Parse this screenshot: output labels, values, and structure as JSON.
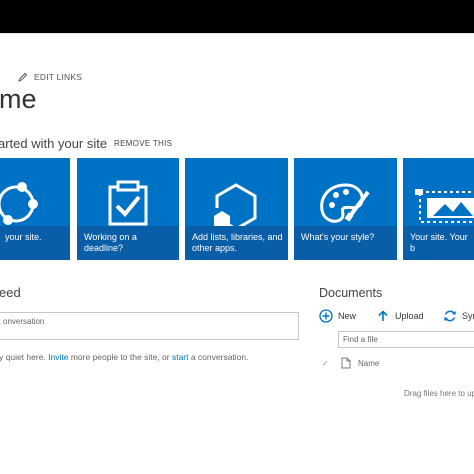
{
  "header": {
    "edit_links": "EDIT LINKS",
    "title": "me"
  },
  "getting_started": {
    "heading": "arted with your site",
    "remove": "REMOVE THIS",
    "tiles": [
      {
        "label": "your site.",
        "icon": "share-network-icon"
      },
      {
        "label": "Working on a deadline?",
        "icon": "clipboard-check-icon"
      },
      {
        "label": "Add lists, libraries, and other apps.",
        "icon": "add-app-hexagon-icon"
      },
      {
        "label": "What's your style?",
        "icon": "palette-icon"
      },
      {
        "label": "Your site. Your b",
        "icon": "site-picture-icon"
      }
    ]
  },
  "newsfeed": {
    "title": "eed",
    "placeholder": "onversation",
    "note_prefix": "y quiet here. ",
    "invite_link": "Invite",
    "note_middle": " more people to the site, or ",
    "start_link": "start",
    "note_suffix": " a conversation."
  },
  "documents": {
    "title": "Documents",
    "new_label": "New",
    "upload_label": "Upload",
    "sync_label": "Syn",
    "find_placeholder": "Find a file",
    "name_column": "Name",
    "drop_text": "Drag files here to up"
  },
  "colors": {
    "tile_blue": "#0072c6",
    "tile_caption": "#0a5ea8",
    "link": "#0072c6",
    "top_bar": "#000000"
  }
}
